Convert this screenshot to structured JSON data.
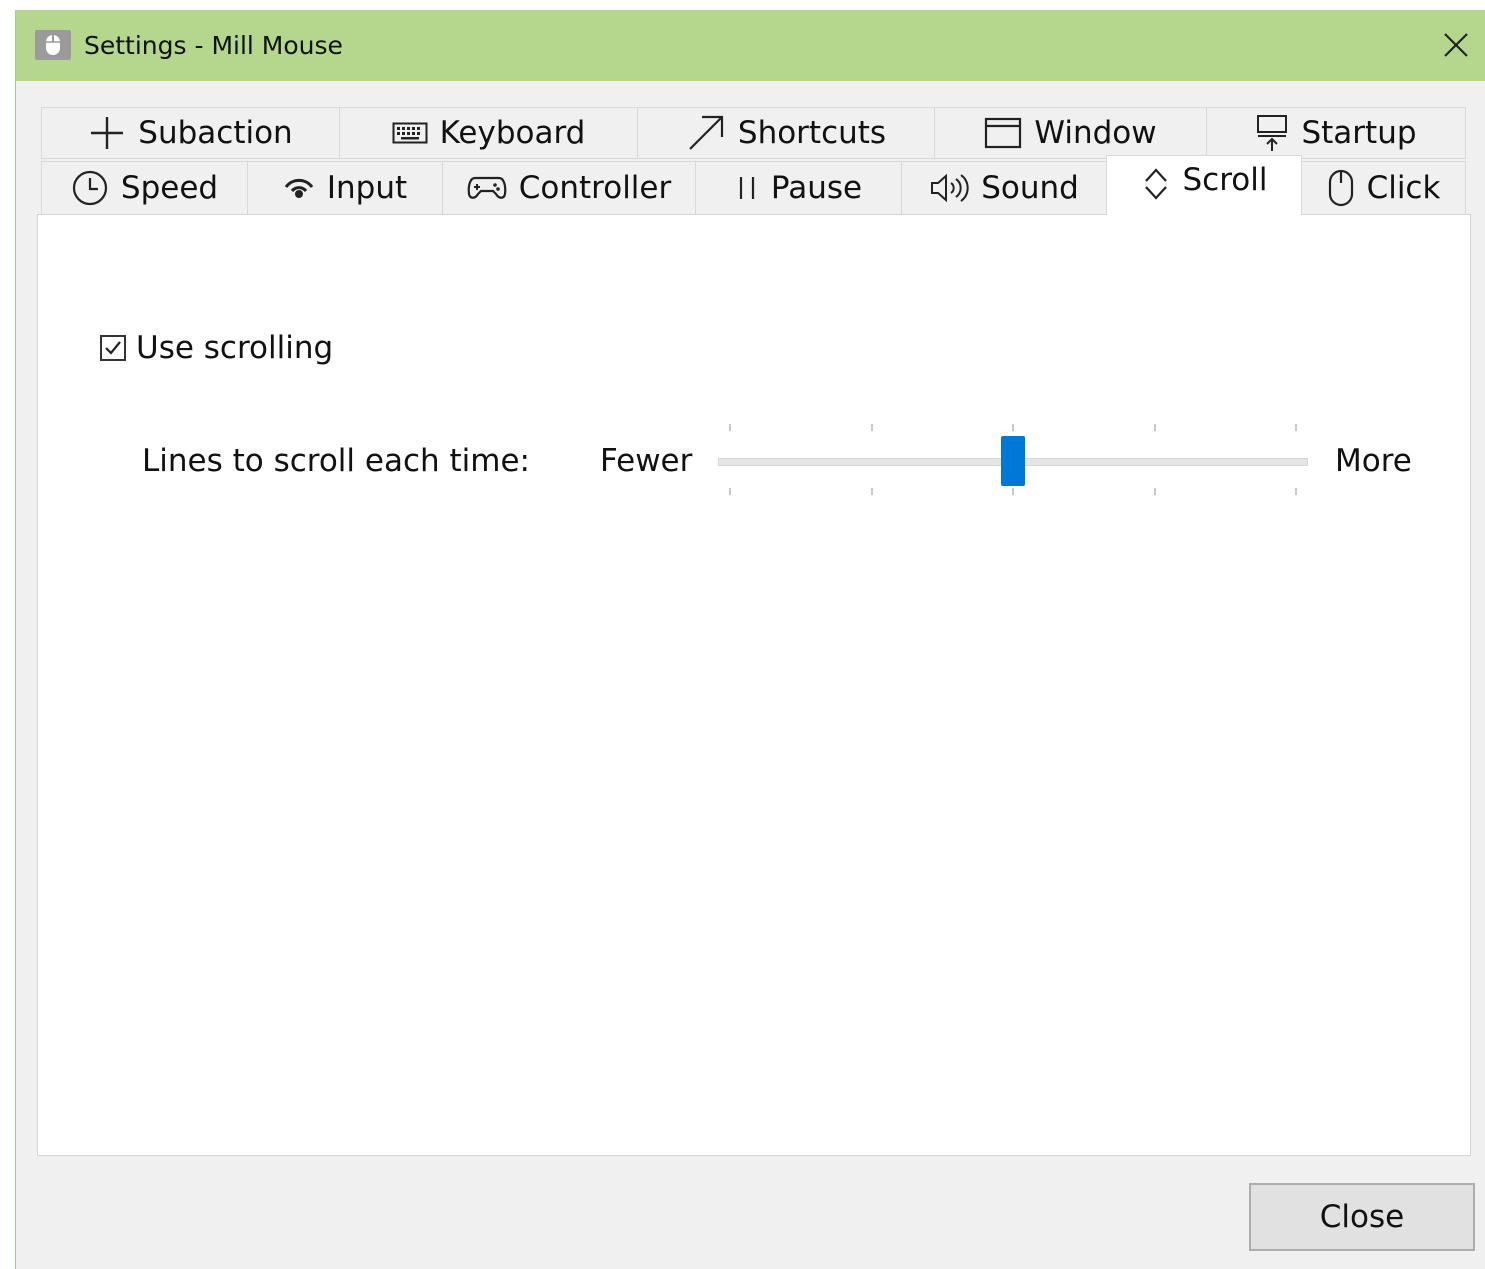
{
  "window": {
    "title": "Settings - Mill Mouse",
    "titlebar_color": "#b5d78d",
    "icon": "mouse-icon",
    "close_icon": "close-icon"
  },
  "tabs": {
    "row_top": [
      {
        "label": "Subaction",
        "icon": "plus-icon"
      },
      {
        "label": "Keyboard",
        "icon": "keyboard-icon"
      },
      {
        "label": "Shortcuts",
        "icon": "arrow-up-right-icon"
      },
      {
        "label": "Window",
        "icon": "window-icon"
      },
      {
        "label": "Startup",
        "icon": "startup-icon"
      }
    ],
    "row_bottom": [
      {
        "label": "Speed",
        "icon": "clock-icon"
      },
      {
        "label": "Input",
        "icon": "signal-icon"
      },
      {
        "label": "Controller",
        "icon": "gamepad-icon"
      },
      {
        "label": "Pause",
        "icon": "pause-icon"
      },
      {
        "label": "Sound",
        "icon": "speaker-icon"
      },
      {
        "label": "Scroll",
        "icon": "up-down-icon"
      },
      {
        "label": "Click",
        "icon": "mouse-outline-icon"
      }
    ],
    "active": "Scroll"
  },
  "scroll": {
    "use_scrolling_label": "Use scrolling",
    "use_scrolling_checked": true,
    "lines_label": "Lines to scroll each time:",
    "fewer_label": "Fewer",
    "more_label": "More",
    "slider": {
      "min": 1,
      "max": 5,
      "value": 3,
      "tick_count": 5
    },
    "accent_color": "#0078d7"
  },
  "footer": {
    "close_label": "Close"
  }
}
